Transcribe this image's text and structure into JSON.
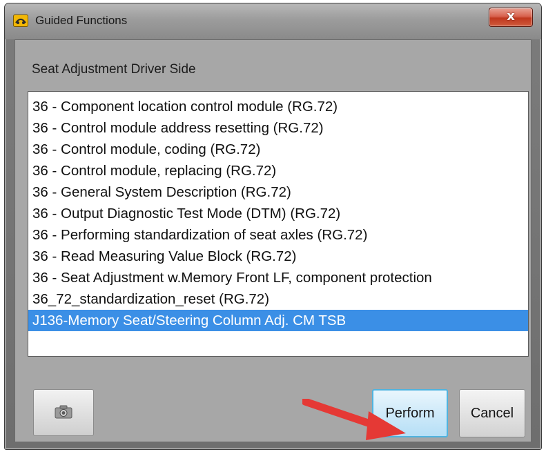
{
  "window": {
    "title": "Guided Functions",
    "close_label": "x"
  },
  "group": {
    "heading": "Seat Adjustment Driver Side"
  },
  "list": {
    "items": [
      "36 - Component location control module (RG.72)",
      "36 - Control module address resetting (RG.72)",
      "36 - Control module, coding (RG.72)",
      "36 - Control module, replacing (RG.72)",
      "36 - General System Description (RG.72)",
      "36 - Output Diagnostic Test Mode (DTM) (RG.72)",
      "36 - Performing standardization of seat axles (RG.72)",
      "36 - Read Measuring Value Block (RG.72)",
      "36 - Seat Adjustment w.Memory Front LF, component protection",
      "36_72_standardization_reset (RG.72)",
      "J136-Memory Seat/Steering Column Adj. CM  TSB"
    ],
    "selected_index": 10
  },
  "buttons": {
    "camera_icon": "camera-icon",
    "perform_label": "Perform",
    "cancel_label": "Cancel"
  },
  "colors": {
    "selection": "#3b8fe6",
    "annotation_arrow": "#e53935",
    "close_button": "#c0381f"
  }
}
